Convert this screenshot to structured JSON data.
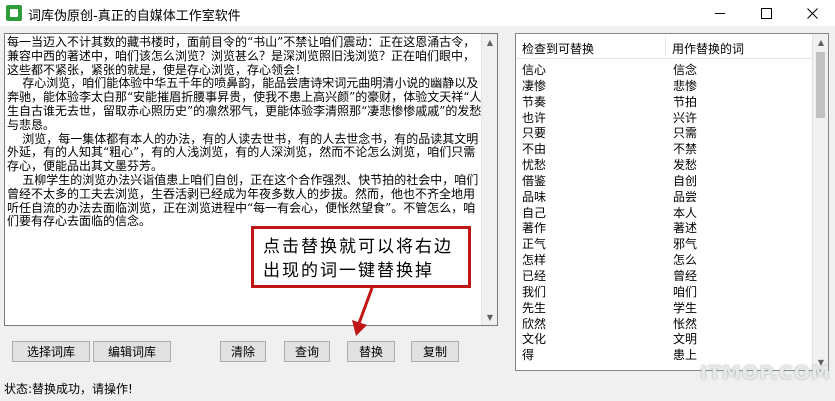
{
  "window": {
    "title": "词库伪原创-真正的自媒体工作室软件",
    "minimize_label": "—",
    "maximize_label": "☐",
    "close_label": "✕"
  },
  "editor": {
    "text": "每一当迈入不计其数的藏书楼时，面前目令的“书山”不禁让咱们震动：正在这恩涌古令，兼容中西的著述中，咱们该怎么浏览？浏览甚么？是深浏览照旧浅浏览？正在咱们眼中，这些都不紧张，紧张的就是，使是存心浏览，存心领会！\n    存心浏览，咱们能体验中华五千年的喷鼻韵，能品尝唐诗宋词元曲明清小说的幽静以及奔驰，能体验李太白那“安能摧眉折腰事昇贵，使我不患上高兴颜”的豪财，体验文天祥“人生自古谁无去世，留取赤心照历史”的凛然邪气，更能体验李清照那“凄悲惨惨戚戚”的发愁与悲恳。\n    浏览，每一集体都有本人的办法，有的人读去世书，有的人去世念书，有的品读其文明外延，有的人知其“粗心”，有的人浅浏览，有的人深浏览，然而不论怎么浏览，咱们只需存心，便能品出其文墨芬芳。\n    五柳学生的浏览办法兴诣值患上咱们自创，正在这个合作强烈、快节拍的社会中，咱们曾经不太多的工夫去浏览，生吞活剥已经成为年夜多数人的步拔。然而，他也不齐全地用听任自流的办法去面临浏览，正在浏览进程中“每一有会心，便怅然望食”。不管怎么，咱们要有存心去面临的信念。"
  },
  "callout": {
    "line1": "点击替换就可以将右边",
    "line2": "出现的词一键替换掉"
  },
  "buttons": {
    "select_lexicon": "选择词库",
    "edit_lexicon": "编辑词库",
    "clear": "清除",
    "query": "查询",
    "replace": "替换",
    "copy": "复制"
  },
  "replace_list": {
    "col_found": "检查到可替换",
    "col_replacement": "用作替换的词",
    "rows": [
      {
        "found": "信心",
        "replacement": "信念"
      },
      {
        "found": "凄惨",
        "replacement": "悲惨"
      },
      {
        "found": "节奏",
        "replacement": "节拍"
      },
      {
        "found": "也许",
        "replacement": "兴许"
      },
      {
        "found": "只要",
        "replacement": "只需"
      },
      {
        "found": "不由",
        "replacement": "不禁"
      },
      {
        "found": "忧愁",
        "replacement": "发愁"
      },
      {
        "found": "借鉴",
        "replacement": "自创"
      },
      {
        "found": "品味",
        "replacement": "品尝"
      },
      {
        "found": "自己",
        "replacement": "本人"
      },
      {
        "found": "著作",
        "replacement": "著述"
      },
      {
        "found": "正气",
        "replacement": "邪气"
      },
      {
        "found": "怎样",
        "replacement": "怎么"
      },
      {
        "found": "已经",
        "replacement": "曾经"
      },
      {
        "found": "我们",
        "replacement": "咱们"
      },
      {
        "found": "先生",
        "replacement": "学生"
      },
      {
        "found": "欣然",
        "replacement": "怅然"
      },
      {
        "found": "文化",
        "replacement": "文明"
      },
      {
        "found": "得",
        "replacement": "患上"
      }
    ]
  },
  "status": {
    "text": "状态:替换成功，请操作!"
  },
  "watermark": {
    "text": "ITMOP.COM"
  }
}
